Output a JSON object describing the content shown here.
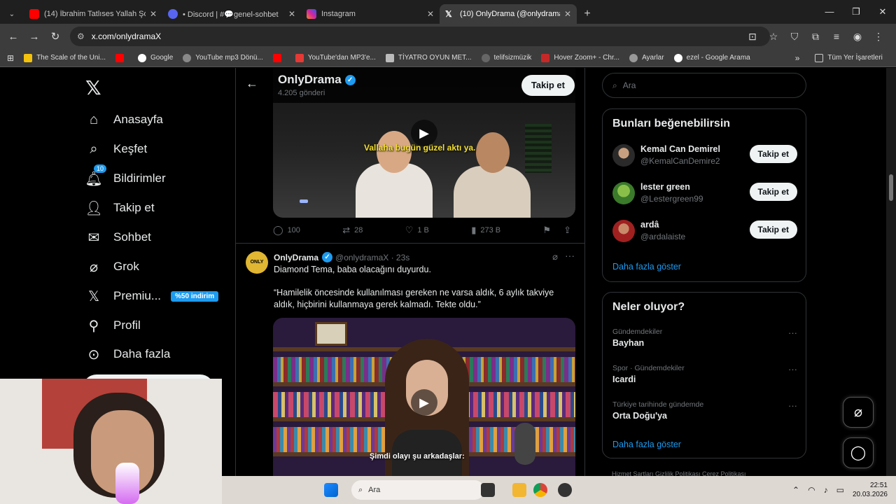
{
  "browser": {
    "tabs": [
      {
        "title": "(14) İbrahim Tatlıses Yallah Şoför...",
        "color": "#ff0000"
      },
      {
        "title": "• Discord | #💬genel-sohbet",
        "color": "#5865f2"
      },
      {
        "title": "Instagram",
        "color": "#d6249f"
      },
      {
        "title": "(10) OnlyDrama (@onlydramaX)",
        "color": "#ffffff"
      }
    ],
    "url": "x.com/onlydramaX",
    "bookmarks": [
      {
        "label": "The Scale of the Uni..."
      },
      {
        "label": ""
      },
      {
        "label": "Google"
      },
      {
        "label": "YouTube mp3 Dönü..."
      },
      {
        "label": ""
      },
      {
        "label": "YouTube'dan MP3'e..."
      },
      {
        "label": "TİYATRO OYUN MET..."
      },
      {
        "label": "telifsizmüzik"
      },
      {
        "label": "Hover Zoom+ - Chr..."
      },
      {
        "label": "Ayarlar"
      },
      {
        "label": "ezel - Google Arama"
      }
    ],
    "bookmarks_all": "Tüm Yer İşaretleri"
  },
  "nav": {
    "items": [
      {
        "label": "Anasayfa"
      },
      {
        "label": "Keşfet"
      },
      {
        "label": "Bildirimler",
        "badge": "10"
      },
      {
        "label": "Takip et"
      },
      {
        "label": "Sohbet"
      },
      {
        "label": "Grok"
      },
      {
        "label": "Premiu...",
        "promo": "%50 indirim"
      },
      {
        "label": "Profil"
      },
      {
        "label": "Daha fazla"
      }
    ]
  },
  "profile_header": {
    "name": "OnlyDrama",
    "count": "4.205 gönderi",
    "follow": "Takip et"
  },
  "tweet1": {
    "subtitle": "Vallaha bugün güzel aktı ya.",
    "replies": "100",
    "retweets": "28",
    "likes": "1 B",
    "views": "273 B"
  },
  "tweet2": {
    "avatar_text": "ONLY DRAMA",
    "name": "OnlyDrama",
    "handle": "@onlydramaX · 23s",
    "line1": "Diamond Tema, baba olacağını duyurdu.",
    "line2": "“Hamilelik öncesinde kullanılması gereken ne varsa aldık, 6 aylık takviye aldık, hiçbirini kullanmaya gerek kalmadı. Tekte oldu.”",
    "subtitle": "Şimdi olayı şu arkadaşlar:"
  },
  "sidebar": {
    "search_placeholder": "Ara",
    "suggest_title": "Bunları beğenebilirsin",
    "suggestions": [
      {
        "name": "Kemal Can Demirel",
        "handle": "@KemalCanDemire2",
        "button": "Takip et"
      },
      {
        "name": "lester green",
        "handle": "@Lestergreen99",
        "button": "Takip et"
      },
      {
        "name": "ardâ",
        "handle": "@ardalaiste",
        "button": "Takip et"
      }
    ],
    "show_more": "Daha fazla göster",
    "trends_title": "Neler oluyor?",
    "trends": [
      {
        "category": "Gündemdekiler",
        "name": "Bayhan"
      },
      {
        "category": "Spor · Gündemdekiler",
        "name": "Icardi"
      },
      {
        "category": "Türkiye tarihinde gündemde",
        "name": "Orta Doğu'ya"
      }
    ],
    "show_more2": "Daha fazla göster",
    "footer": "Hizmet Şartları   Gizlilik Politikası   Çerez Politikası"
  },
  "taskbar": {
    "search": "Ara",
    "time": "22:51",
    "date": "20.03.2026"
  },
  "colors": {
    "accent": "#1d9bf0",
    "background": "#000000"
  }
}
